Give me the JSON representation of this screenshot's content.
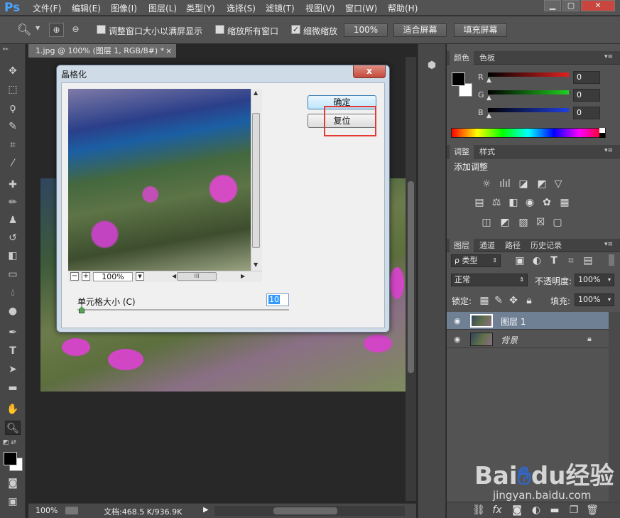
{
  "app": {
    "logo": "Ps"
  },
  "menu": [
    "文件(F)",
    "编辑(E)",
    "图像(I)",
    "图层(L)",
    "类型(Y)",
    "选择(S)",
    "滤镜(T)",
    "视图(V)",
    "窗口(W)",
    "帮助(H)"
  ],
  "window_controls": {
    "minimize": "▁",
    "maximize": "▢",
    "close": "✕"
  },
  "options": {
    "resize_windows": "调整窗口大小以满屏显示",
    "zoom_all": "缩放所有窗口",
    "scrubby_zoom": "细微缩放",
    "zoom_100": "100%",
    "fit_screen": "适合屏幕",
    "fill_screen": "填充屏幕",
    "scrubby_checked": "✓"
  },
  "document": {
    "tab": "1.jpg @ 100% (图层 1, RGB/8#) *",
    "tab_close": "×"
  },
  "statusbar": {
    "zoom": "100%",
    "doc_info": "文档:468.5 K/936.9K"
  },
  "dialog": {
    "title": "晶格化",
    "close": "x",
    "ok": "确定",
    "reset": "复位",
    "preview_zoom": "100%",
    "zoom_out": "−",
    "zoom_in": "+",
    "hscroll_grip": "III",
    "cell_size_label": "单元格大小 (C)",
    "cell_size_value": "10"
  },
  "color_panel": {
    "tabs": [
      "颜色",
      "色板"
    ],
    "channels": [
      {
        "name": "R",
        "value": "0",
        "color": "#d02020"
      },
      {
        "name": "G",
        "value": "0",
        "color": "#20c020"
      },
      {
        "name": "B",
        "value": "0",
        "color": "#2040d0"
      }
    ]
  },
  "adjust_panel": {
    "tabs": [
      "调整",
      "样式"
    ],
    "heading": "添加调整"
  },
  "layers_panel": {
    "tabs": [
      "图层",
      "通道",
      "路径",
      "历史记录"
    ],
    "filter_kind": "ρ 类型",
    "blend_mode": "正常",
    "opacity_label": "不透明度:",
    "opacity_value": "100%",
    "lock_label": "锁定:",
    "fill_label": "填充:",
    "fill_value": "100%",
    "layers": [
      {
        "name": "图层 1",
        "selected": true
      },
      {
        "name": "背景",
        "locked": true
      }
    ],
    "footer_icons": [
      "link-icon",
      "fx-icon",
      "mask-icon",
      "adjustment-icon",
      "group-icon",
      "new-layer-icon",
      "trash-icon"
    ],
    "fx_label": "fx"
  },
  "watermark": {
    "logo_left": "Bai",
    "logo_mid": "du",
    "logo_right": "经验",
    "url": "jingyan.baidu.com"
  }
}
